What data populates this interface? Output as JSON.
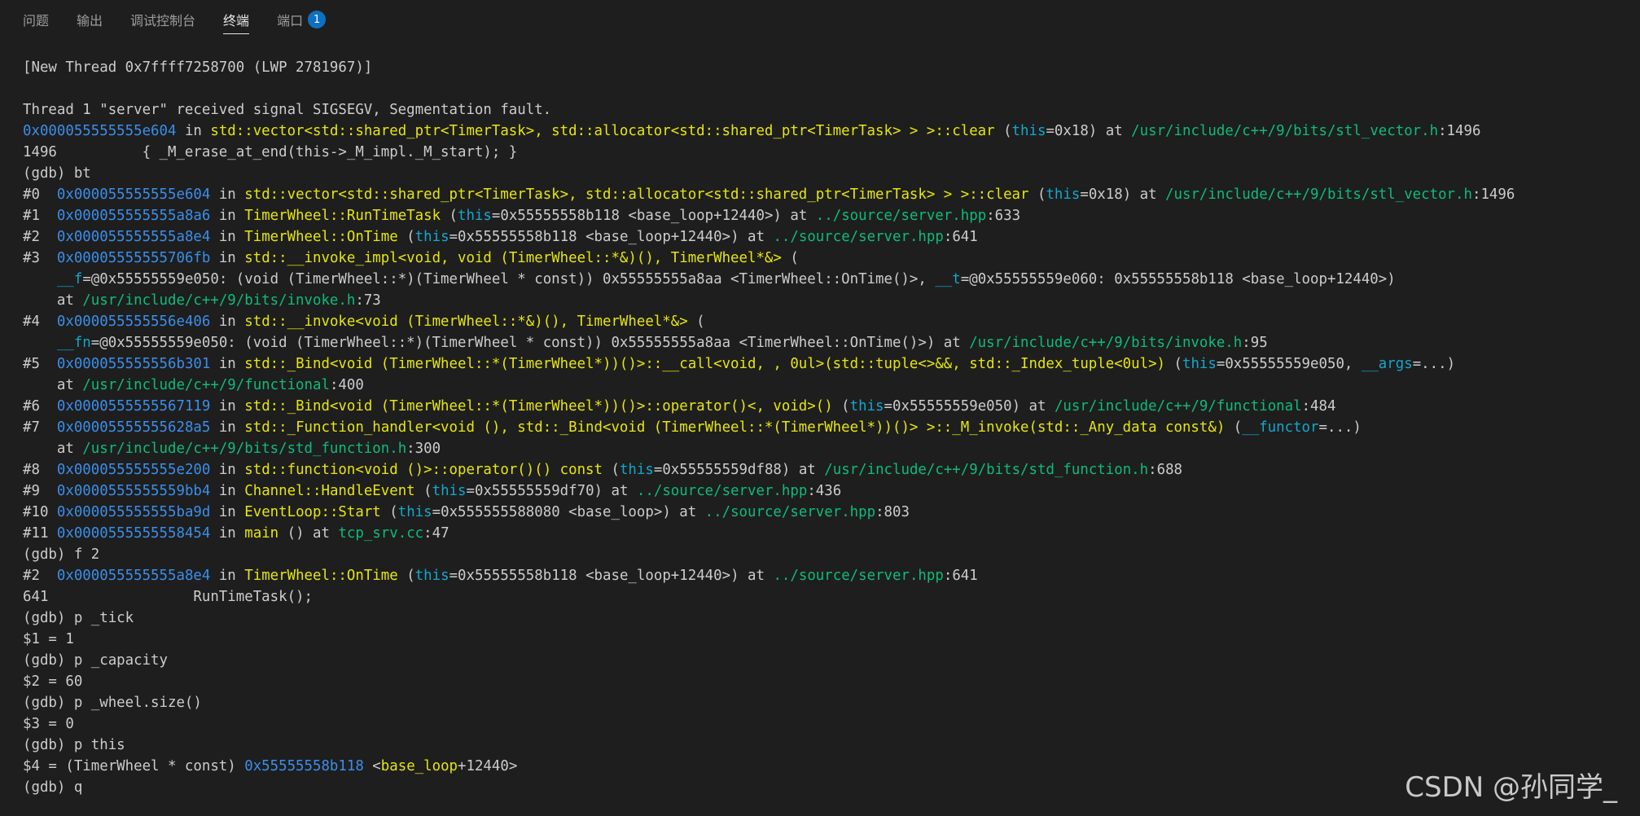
{
  "tabs": [
    {
      "label": "问题",
      "active": false
    },
    {
      "label": "输出",
      "active": false
    },
    {
      "label": "调试控制台",
      "active": false
    },
    {
      "label": "终端",
      "active": true
    },
    {
      "label": "端口",
      "active": false,
      "badge": "1"
    }
  ],
  "colors": {
    "background": "#1e1e1e",
    "text": "#cccccc",
    "address": "#3b8eea",
    "function": "#e5e510",
    "path": "#0dbc79",
    "argument": "#11a8cd",
    "badge": "#0e70c0"
  },
  "terminal_lines": [
    [
      {
        "t": "[New Thread 0x7ffff7258700 (LWP 2781967)]"
      }
    ],
    [
      {
        "t": ""
      }
    ],
    [
      {
        "t": "Thread 1 \"server\" received signal SIGSEGV, Segmentation fault."
      }
    ],
    [
      {
        "t": "0x000055555555e604",
        "c": "addr"
      },
      {
        "t": " in "
      },
      {
        "t": "std::vector<std::shared_ptr<TimerTask>, std::allocator<std::shared_ptr<TimerTask> > >::clear",
        "c": "func"
      },
      {
        "t": " ("
      },
      {
        "t": "this",
        "c": "arg"
      },
      {
        "t": "=0x18) at "
      },
      {
        "t": "/usr/include/c++/9/bits/stl_vector.h",
        "c": "path"
      },
      {
        "t": ":1496"
      }
    ],
    [
      {
        "t": "1496          { _M_erase_at_end(this->_M_impl._M_start); }"
      }
    ],
    [
      {
        "t": "(gdb) bt"
      }
    ],
    [
      {
        "t": "#0  "
      },
      {
        "t": "0x000055555555e604",
        "c": "addr"
      },
      {
        "t": " in "
      },
      {
        "t": "std::vector<std::shared_ptr<TimerTask>, std::allocator<std::shared_ptr<TimerTask> > >::clear",
        "c": "func"
      },
      {
        "t": " ("
      },
      {
        "t": "this",
        "c": "arg"
      },
      {
        "t": "=0x18) at "
      },
      {
        "t": "/usr/include/c++/9/bits/stl_vector.h",
        "c": "path"
      },
      {
        "t": ":1496"
      }
    ],
    [
      {
        "t": "#1  "
      },
      {
        "t": "0x000055555555a8a6",
        "c": "addr"
      },
      {
        "t": " in "
      },
      {
        "t": "TimerWheel::RunTimeTask",
        "c": "func"
      },
      {
        "t": " ("
      },
      {
        "t": "this",
        "c": "arg"
      },
      {
        "t": "=0x55555558b118 <base_loop+12440>) at "
      },
      {
        "t": "../source/server.hpp",
        "c": "path"
      },
      {
        "t": ":633"
      }
    ],
    [
      {
        "t": "#2  "
      },
      {
        "t": "0x000055555555a8e4",
        "c": "addr"
      },
      {
        "t": " in "
      },
      {
        "t": "TimerWheel::OnTime",
        "c": "func"
      },
      {
        "t": " ("
      },
      {
        "t": "this",
        "c": "arg"
      },
      {
        "t": "=0x55555558b118 <base_loop+12440>) at "
      },
      {
        "t": "../source/server.hpp",
        "c": "path"
      },
      {
        "t": ":641"
      }
    ],
    [
      {
        "t": "#3  "
      },
      {
        "t": "0x00005555555706fb",
        "c": "addr"
      },
      {
        "t": " in "
      },
      {
        "t": "std::__invoke_impl<void, void (TimerWheel::*&)(), TimerWheel*&>",
        "c": "func"
      },
      {
        "t": " ("
      }
    ],
    [
      {
        "t": "    "
      },
      {
        "t": "__f",
        "c": "arg"
      },
      {
        "t": "=@0x55555559e050: (void (TimerWheel::*)(TimerWheel * const)) 0x55555555a8aa <TimerWheel::OnTime()>, "
      },
      {
        "t": "__t",
        "c": "arg"
      },
      {
        "t": "=@0x55555559e060: 0x55555558b118 <base_loop+12440>)"
      }
    ],
    [
      {
        "t": "    at "
      },
      {
        "t": "/usr/include/c++/9/bits/invoke.h",
        "c": "path"
      },
      {
        "t": ":73"
      }
    ],
    [
      {
        "t": "#4  "
      },
      {
        "t": "0x000055555556e406",
        "c": "addr"
      },
      {
        "t": " in "
      },
      {
        "t": "std::__invoke<void (TimerWheel::*&)(), TimerWheel*&>",
        "c": "func"
      },
      {
        "t": " ("
      }
    ],
    [
      {
        "t": "    "
      },
      {
        "t": "__fn",
        "c": "arg"
      },
      {
        "t": "=@0x55555559e050: (void (TimerWheel::*)(TimerWheel * const)) 0x55555555a8aa <TimerWheel::OnTime()>) at "
      },
      {
        "t": "/usr/include/c++/9/bits/invoke.h",
        "c": "path"
      },
      {
        "t": ":95"
      }
    ],
    [
      {
        "t": "#5  "
      },
      {
        "t": "0x000055555556b301",
        "c": "addr"
      },
      {
        "t": " in "
      },
      {
        "t": "std::_Bind<void (TimerWheel::*(TimerWheel*))()>::__call<void, , 0ul>(std::tuple<>&&, std::_Index_tuple<0ul>)",
        "c": "func"
      },
      {
        "t": " ("
      },
      {
        "t": "this",
        "c": "arg"
      },
      {
        "t": "=0x55555559e050, "
      },
      {
        "t": "__args",
        "c": "arg"
      },
      {
        "t": "=...)"
      }
    ],
    [
      {
        "t": "    at "
      },
      {
        "t": "/usr/include/c++/9/functional",
        "c": "path"
      },
      {
        "t": ":400"
      }
    ],
    [
      {
        "t": "#6  "
      },
      {
        "t": "0x0000555555567119",
        "c": "addr"
      },
      {
        "t": " in "
      },
      {
        "t": "std::_Bind<void (TimerWheel::*(TimerWheel*))()>::operator()<, void>()",
        "c": "func"
      },
      {
        "t": " ("
      },
      {
        "t": "this",
        "c": "arg"
      },
      {
        "t": "=0x55555559e050) at "
      },
      {
        "t": "/usr/include/c++/9/functional",
        "c": "path"
      },
      {
        "t": ":484"
      }
    ],
    [
      {
        "t": "#7  "
      },
      {
        "t": "0x00005555555628a5",
        "c": "addr"
      },
      {
        "t": " in "
      },
      {
        "t": "std::_Function_handler<void (), std::_Bind<void (TimerWheel::*(TimerWheel*))()> >::_M_invoke(std::_Any_data const&)",
        "c": "func"
      },
      {
        "t": " ("
      },
      {
        "t": "__functor",
        "c": "arg"
      },
      {
        "t": "=...)"
      }
    ],
    [
      {
        "t": "    at "
      },
      {
        "t": "/usr/include/c++/9/bits/std_function.h",
        "c": "path"
      },
      {
        "t": ":300"
      }
    ],
    [
      {
        "t": "#8  "
      },
      {
        "t": "0x000055555555e200",
        "c": "addr"
      },
      {
        "t": " in "
      },
      {
        "t": "std::function<void ()>::operator()() const",
        "c": "func"
      },
      {
        "t": " ("
      },
      {
        "t": "this",
        "c": "arg"
      },
      {
        "t": "=0x55555559df88) at "
      },
      {
        "t": "/usr/include/c++/9/bits/std_function.h",
        "c": "path"
      },
      {
        "t": ":688"
      }
    ],
    [
      {
        "t": "#9  "
      },
      {
        "t": "0x0000555555559bb4",
        "c": "addr"
      },
      {
        "t": " in "
      },
      {
        "t": "Channel::HandleEvent",
        "c": "func"
      },
      {
        "t": " ("
      },
      {
        "t": "this",
        "c": "arg"
      },
      {
        "t": "=0x55555559df70) at "
      },
      {
        "t": "../source/server.hpp",
        "c": "path"
      },
      {
        "t": ":436"
      }
    ],
    [
      {
        "t": "#10 "
      },
      {
        "t": "0x000055555555ba9d",
        "c": "addr"
      },
      {
        "t": " in "
      },
      {
        "t": "EventLoop::Start",
        "c": "func"
      },
      {
        "t": " ("
      },
      {
        "t": "this",
        "c": "arg"
      },
      {
        "t": "=0x555555588080 <base_loop>) at "
      },
      {
        "t": "../source/server.hpp",
        "c": "path"
      },
      {
        "t": ":803"
      }
    ],
    [
      {
        "t": "#11 "
      },
      {
        "t": "0x0000555555558454",
        "c": "addr"
      },
      {
        "t": " in "
      },
      {
        "t": "main",
        "c": "func"
      },
      {
        "t": " () at "
      },
      {
        "t": "tcp_srv.cc",
        "c": "path"
      },
      {
        "t": ":47"
      }
    ],
    [
      {
        "t": "(gdb) f 2"
      }
    ],
    [
      {
        "t": "#2  "
      },
      {
        "t": "0x000055555555a8e4",
        "c": "addr"
      },
      {
        "t": " in "
      },
      {
        "t": "TimerWheel::OnTime",
        "c": "func"
      },
      {
        "t": " ("
      },
      {
        "t": "this",
        "c": "arg"
      },
      {
        "t": "=0x55555558b118 <base_loop+12440>) at "
      },
      {
        "t": "../source/server.hpp",
        "c": "path"
      },
      {
        "t": ":641"
      }
    ],
    [
      {
        "t": "641                 RunTimeTask();"
      }
    ],
    [
      {
        "t": "(gdb) p _tick"
      }
    ],
    [
      {
        "t": "$1 = 1"
      }
    ],
    [
      {
        "t": "(gdb) p _capacity"
      }
    ],
    [
      {
        "t": "$2 = 60"
      }
    ],
    [
      {
        "t": "(gdb) p _wheel.size()"
      }
    ],
    [
      {
        "t": "$3 = 0"
      }
    ],
    [
      {
        "t": "(gdb) p this"
      }
    ],
    [
      {
        "t": "$4 = (TimerWheel * const) "
      },
      {
        "t": "0x55555558b118",
        "c": "addr"
      },
      {
        "t": " <"
      },
      {
        "t": "base_loop",
        "c": "func"
      },
      {
        "t": "+12440>"
      }
    ],
    [
      {
        "t": "(gdb) q"
      }
    ]
  ],
  "watermark": "CSDN @孙同学_"
}
